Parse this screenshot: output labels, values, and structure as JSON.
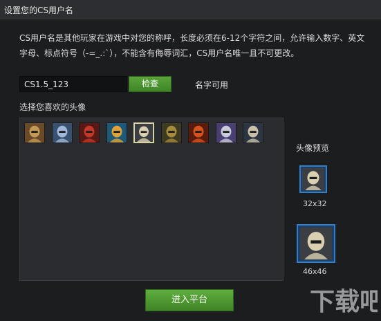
{
  "window": {
    "title": "设置您的CS用户名"
  },
  "description": "CS用户名是其他玩家在游戏中对您的称呼，长度必须在6-12个字符之间，允许输入数字、英文字母、标点符号（-=_.:`），不能含有侮辱词汇，CS用户名唯一且不可更改。",
  "username": {
    "value": "CS1.5_123",
    "check_label": "检查",
    "status": "名字可用"
  },
  "avatars": {
    "label": "选择您喜欢的头像",
    "items": [
      {
        "icon": "hero-avatar-1-icon",
        "colors": [
          "#c29a55",
          "#6b4a2a"
        ]
      },
      {
        "icon": "hero-avatar-2-icon",
        "colors": [
          "#9fb7d8",
          "#39506e"
        ]
      },
      {
        "icon": "hero-avatar-3-icon",
        "colors": [
          "#c0392b",
          "#5a1814"
        ]
      },
      {
        "icon": "hero-avatar-4-icon",
        "colors": [
          "#e0a33a",
          "#1d5a7a"
        ]
      },
      {
        "icon": "hero-avatar-5-icon",
        "colors": [
          "#d8d0b0",
          "#3b3f44"
        ]
      },
      {
        "icon": "hero-avatar-6-icon",
        "colors": [
          "#a58a3d",
          "#3d3a22"
        ]
      },
      {
        "icon": "hero-avatar-7-icon",
        "colors": [
          "#d4541f",
          "#5a1b0c"
        ]
      },
      {
        "icon": "hero-avatar-8-icon",
        "colors": [
          "#c9c9dc",
          "#4a3f73"
        ]
      },
      {
        "icon": "hero-avatar-9-icon",
        "colors": [
          "#c8c0a8",
          "#2c3542"
        ]
      }
    ],
    "selected_index": 4
  },
  "preview": {
    "label": "头像预览",
    "small_size": "32x32",
    "large_size": "46x46"
  },
  "enter_button": {
    "label": "进入平台"
  },
  "watermark": {
    "text": "下载吧",
    "url": "www.xiazaiba.com"
  },
  "colors": {
    "accent_green": "#4a9a30",
    "preview_border": "#2f7fcd"
  }
}
